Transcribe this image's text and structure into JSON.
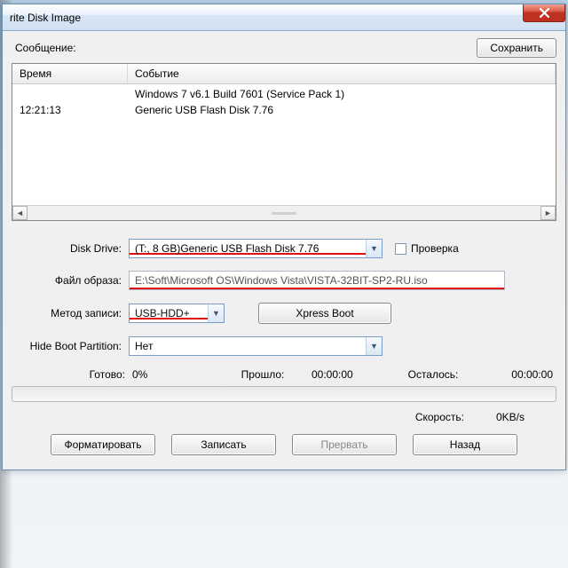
{
  "window": {
    "title": "rite Disk Image"
  },
  "msg": {
    "label": "Сообщение:",
    "save": "Сохранить"
  },
  "log": {
    "col_time": "Время",
    "col_event": "Событие",
    "rows": [
      {
        "time": "",
        "event": "Windows 7 v6.1 Build 7601 (Service Pack 1)"
      },
      {
        "time": "12:21:13",
        "event": "Generic USB Flash Disk  7.76"
      }
    ]
  },
  "form": {
    "disk_drive_label": "Disk Drive:",
    "disk_drive_value": "(T:, 8 GB)Generic USB Flash Disk  7.76",
    "verify_label": "Проверка",
    "image_label": "Файл образа:",
    "image_value": "E:\\Soft\\Microsoft OS\\Windows Vista\\VISTA-32BIT-SP2-RU.iso",
    "method_label": "Метод записи:",
    "method_value": "USB-HDD+",
    "xpress": "Xpress Boot",
    "hide_label": "Hide Boot Partition:",
    "hide_value": "Нет"
  },
  "status": {
    "ready_label": "Готово:",
    "ready_value": "0%",
    "elapsed_label": "Прошло:",
    "elapsed_value": "00:00:00",
    "remain_label": "Осталось:",
    "remain_value": "00:00:00",
    "speed_label": "Скорость:",
    "speed_value": "0KB/s"
  },
  "buttons": {
    "format": "Форматировать",
    "write": "Записать",
    "abort": "Прервать",
    "back": "Назад"
  }
}
